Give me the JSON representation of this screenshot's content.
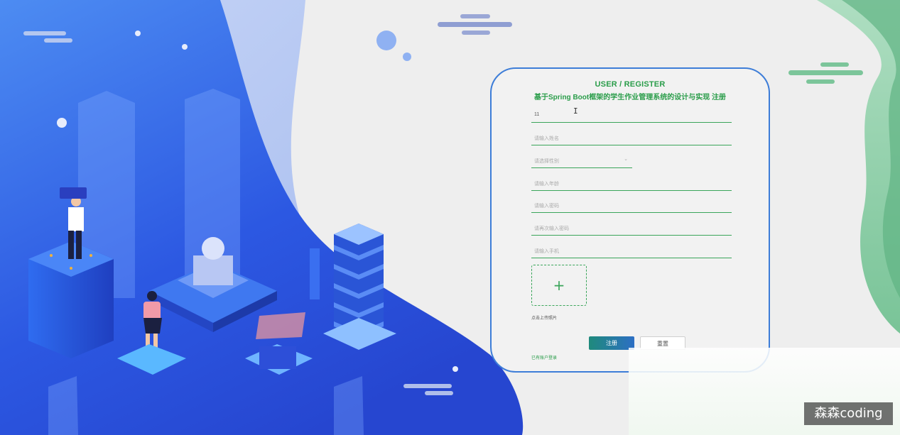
{
  "form": {
    "heading": "USER / REGISTER",
    "subtitle": "基于Spring Boot框架的学生作业管理系统的设计与实现 注册",
    "fields": [
      {
        "value": "11",
        "placeholder": ""
      },
      {
        "value": "",
        "placeholder": "请输入姓名"
      },
      {
        "value": "",
        "placeholder": "请选择性别"
      },
      {
        "value": "",
        "placeholder": "请输入年龄"
      },
      {
        "value": "",
        "placeholder": "请输入密码"
      },
      {
        "value": "",
        "placeholder": "请再次输入密码"
      },
      {
        "value": "",
        "placeholder": "请输入手机"
      }
    ],
    "upload_label": "点击上传照片",
    "register_label": "注册",
    "reset_label": "重置",
    "login_link": "已有账户登录"
  },
  "watermark": "森森coding",
  "colors": {
    "accent": "#2a9d4a",
    "card_border": "#3d7dd8",
    "bg_blue": "#2f5fe0",
    "bg_green": "#7cc59a"
  }
}
